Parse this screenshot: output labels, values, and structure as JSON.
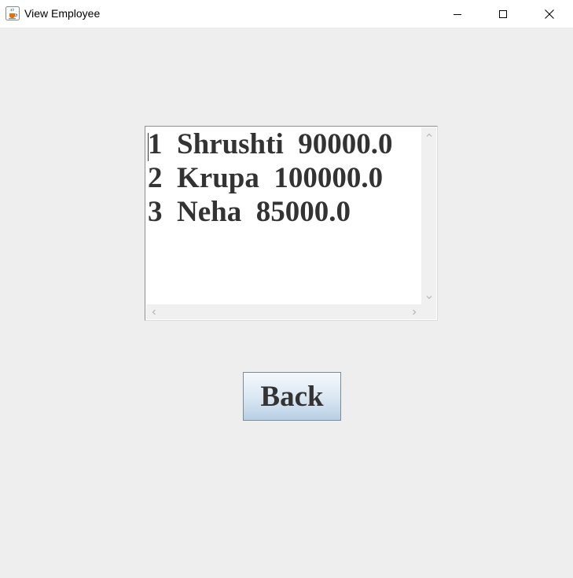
{
  "window": {
    "title": "View Employee",
    "app_icon": "java-cup-icon",
    "controls": [
      "minimize-icon",
      "maximize-icon",
      "close-icon"
    ]
  },
  "employees": [
    {
      "id": "1",
      "name": "Shrushti",
      "salary": "90000.0",
      "line": "1  Shrushti  90000.0"
    },
    {
      "id": "2",
      "name": "Krupa",
      "salary": "100000.0",
      "line": "2  Krupa  100000.0"
    },
    {
      "id": "3",
      "name": "Neha",
      "salary": "85000.0",
      "line": "3  Neha  85000.0"
    }
  ],
  "back_button": {
    "label": "Back"
  },
  "colors": {
    "background": "#eeeeee",
    "text": "#333333",
    "button_border": "#7a8a99",
    "button_gradient_bottom": "#b8cfe5"
  }
}
